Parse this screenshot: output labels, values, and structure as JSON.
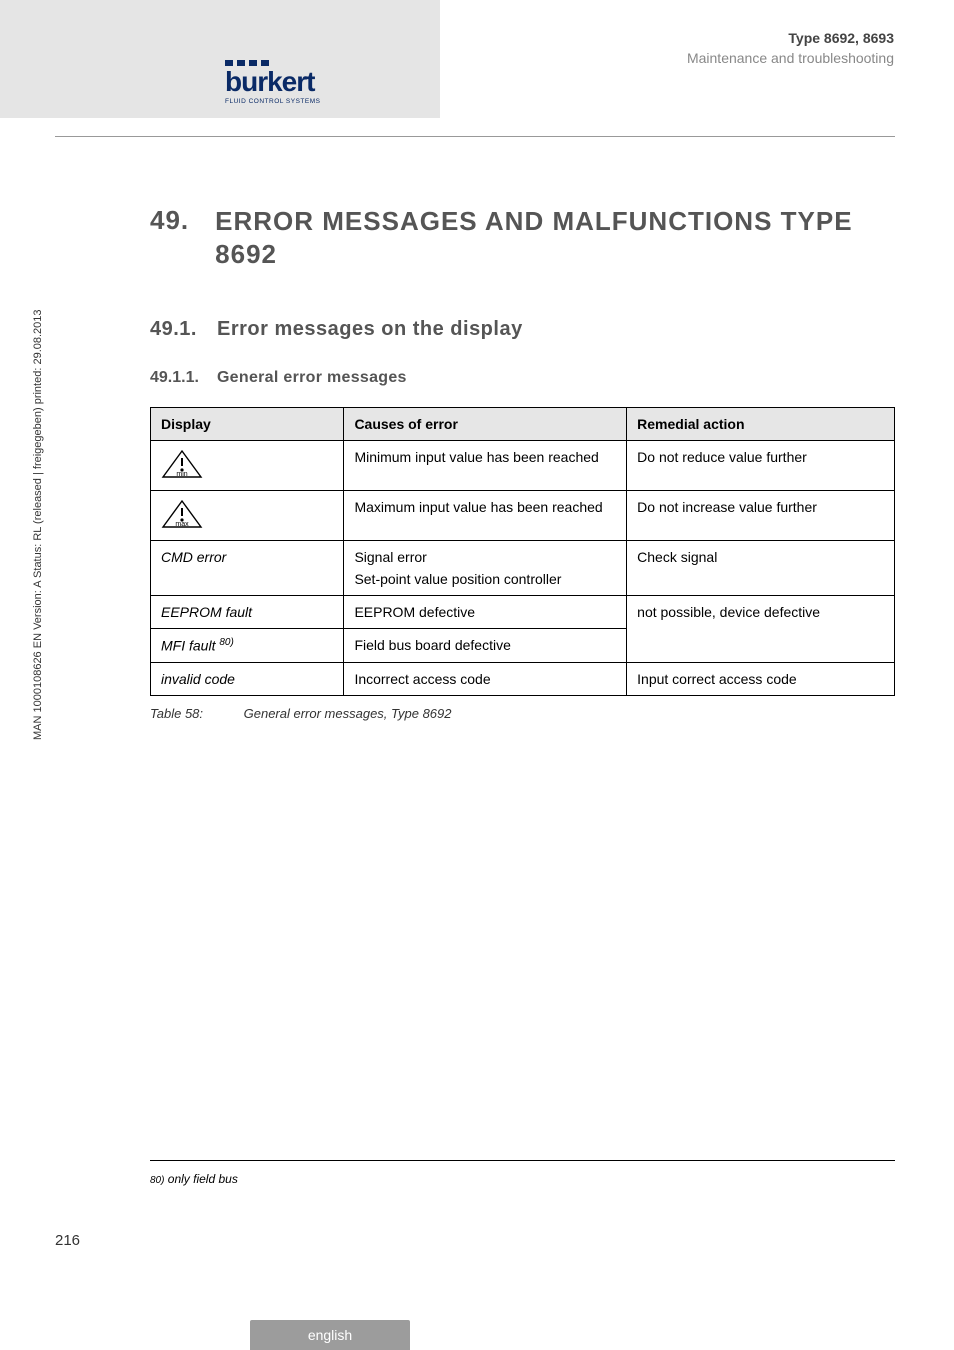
{
  "header": {
    "type_line": "Type 8692, 8693",
    "section_line": "Maintenance and troubleshooting",
    "logo_word": "burkert",
    "logo_tag": "FLUID CONTROL SYSTEMS"
  },
  "sidetext": "MAN 1000108626 EN Version: A Status: RL (released | freigegeben) printed: 29.08.2013",
  "headings": {
    "h1_num": "49.",
    "h1_txt": "ERROR MESSAGES AND MALFUNCTIONS TYPE 8692",
    "h2_num": "49.1.",
    "h2_txt": "Error messages on the display",
    "h3_num": "49.1.1.",
    "h3_txt": "General error messages"
  },
  "table": {
    "headers": {
      "c1": "Display",
      "c2": "Causes of error",
      "c3": "Remedial action"
    },
    "rows": [
      {
        "display_type": "icon",
        "icon_label": "min",
        "cause": "Minimum input value has been reached",
        "cause2": "",
        "remedial": "Do not reduce value further"
      },
      {
        "display_type": "icon",
        "icon_label": "max",
        "cause": "Maximum input value has been reached",
        "cause2": "",
        "remedial": "Do not increase value further"
      },
      {
        "display_type": "text",
        "display_text": "CMD error",
        "cause": "Signal error",
        "cause2": "Set-point value  position controller",
        "remedial": "Check signal"
      },
      {
        "display_type": "text",
        "display_text": "EEPROM fault",
        "cause": "EEPROM defective",
        "cause2": "",
        "remedial": "not possible, device defective",
        "rowspan_remedial": 2
      },
      {
        "display_type": "text_sup",
        "display_text": "MFI fault ",
        "sup": "80)",
        "cause": "Field bus board defective",
        "cause2": ""
      },
      {
        "display_type": "text",
        "display_text": "invalid code",
        "cause": "Incorrect access code",
        "cause2": "",
        "remedial": "Input correct access code"
      }
    ],
    "caption_label": "Table 58:",
    "caption_text": "General error messages, Type 8692"
  },
  "footnote": {
    "num": "80)",
    "text": " only field bus"
  },
  "pagenum": "216",
  "footer_lang": "english"
}
